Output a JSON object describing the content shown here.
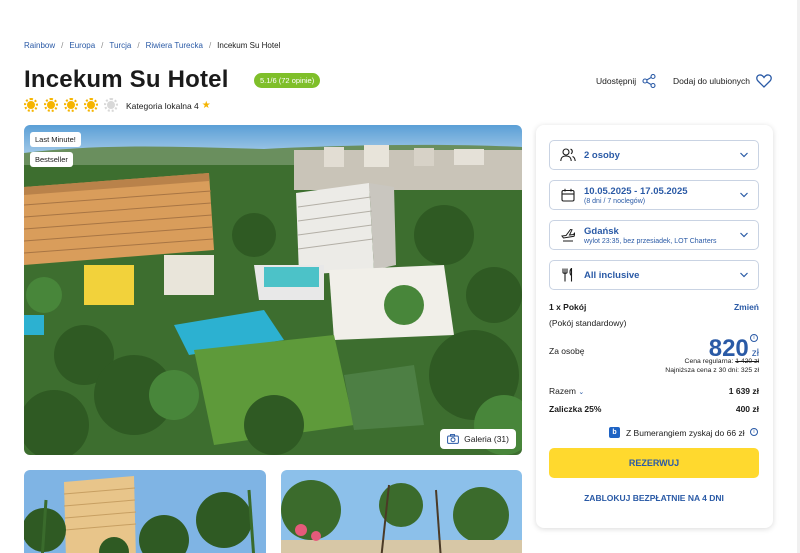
{
  "breadcrumb": [
    "Rainbow",
    "Europa",
    "Turcja",
    "Riwiera Turecka",
    "Incekum Su Hotel"
  ],
  "hotel": {
    "title": "Incekum Su Hotel",
    "rating_badge": "5.1/6 (72 opinie)",
    "suns_filled": 4,
    "suns_total": 5,
    "category": "Kategoria lokalna 4"
  },
  "actions": {
    "share": "Udostępnij",
    "favorite": "Dodaj do ulubionych"
  },
  "photo": {
    "tags": [
      "Last Minute!",
      "Bestseller"
    ],
    "gallery": "Galeria (31)"
  },
  "booking": {
    "persons": "2 osoby",
    "dates": "10.05.2025 - 17.05.2025",
    "dates_sub": "(8 dni / 7 noclegów)",
    "departure": "Gdańsk",
    "departure_sub": "wylot 23:35, bez przesiadek, LOT Charters",
    "board": "All inclusive",
    "room_count": "1 x Pokój",
    "room_change": "Zmień",
    "room_type": "(Pokój standardowy)",
    "per_person_label": "Za osobę",
    "price": "820",
    "currency": "zł",
    "regular_label": "Cena regularna:",
    "regular_price": "1 420 zł",
    "lowest_30": "Najniższa cena z 30 dni: 325 zł",
    "total_label": "Razem",
    "total_value": "1 639 zł",
    "deposit_label": "Zaliczka 25%",
    "deposit_value": "400 zł",
    "bumerang": "Z Bumerangiem zyskaj do 66 zł",
    "reserve": "REZERWUJ",
    "block": "ZABLOKUJ BEZPŁATNIE NA 4 DNI"
  },
  "colors": {
    "accent": "#2a5aa6",
    "button": "#ffd92e",
    "badge": "#7fbf2a",
    "sun": "#f5b400"
  }
}
